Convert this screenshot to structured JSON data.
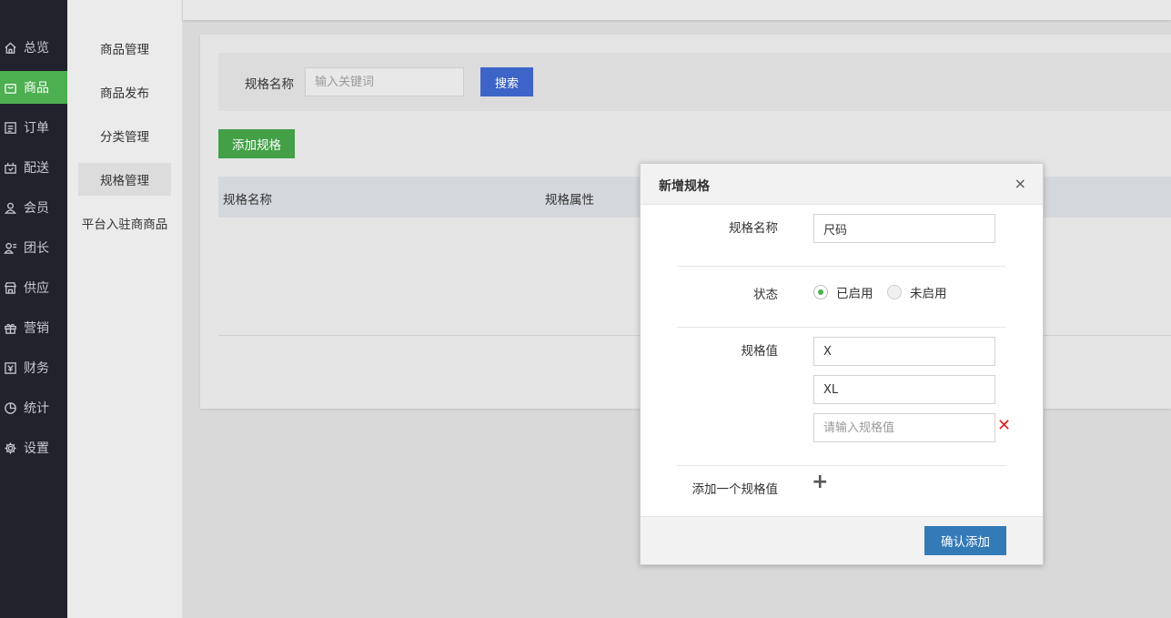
{
  "nav": {
    "items": [
      {
        "label": "总览",
        "icon": "home-icon"
      },
      {
        "label": "商品",
        "icon": "bag-icon"
      },
      {
        "label": "订单",
        "icon": "order-icon"
      },
      {
        "label": "配送",
        "icon": "delivery-icon"
      },
      {
        "label": "会员",
        "icon": "user-icon"
      },
      {
        "label": "团长",
        "icon": "leader-icon"
      },
      {
        "label": "供应",
        "icon": "store-icon"
      },
      {
        "label": "营销",
        "icon": "gift-icon"
      },
      {
        "label": "财务",
        "icon": "finance-icon"
      },
      {
        "label": "统计",
        "icon": "pie-chart-icon"
      },
      {
        "label": "设置",
        "icon": "gear-icon"
      }
    ],
    "active_index": 1
  },
  "subnav": {
    "items": [
      "商品管理",
      "商品发布",
      "分类管理",
      "规格管理",
      "平台入驻商商品"
    ],
    "active_index": 3
  },
  "search": {
    "label": "规格名称",
    "placeholder": "输入关键词",
    "button_label": "搜索"
  },
  "add_button_label": "添加规格",
  "table": {
    "columns": [
      "规格名称",
      "规格属性"
    ]
  },
  "modal": {
    "title": "新增规格",
    "close_label": "×",
    "name_label": "规格名称",
    "name_value": "尺码",
    "status_label": "状态",
    "status_options": [
      "已启用",
      "未启用"
    ],
    "status_selected": "已启用",
    "values_label": "规格值",
    "values": [
      "X",
      "XL",
      ""
    ],
    "value_placeholder": "请输入规格值",
    "remove_label": "✕",
    "add_value_label": "添加一个规格值",
    "add_value_icon": "+",
    "confirm_label": "确认添加"
  },
  "colors": {
    "nav_bg": "#22222c",
    "active_green": "#4caf50",
    "search_blue": "#3d64c8",
    "confirm_blue": "#337ab7",
    "remove_red": "#e02020"
  }
}
